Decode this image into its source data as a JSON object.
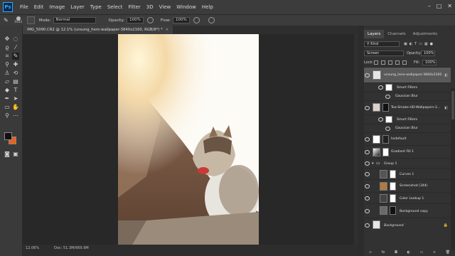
{
  "app": {
    "logo": "Ps"
  },
  "menu": [
    "File",
    "Edit",
    "Image",
    "Layer",
    "Type",
    "Select",
    "Filter",
    "3D",
    "View",
    "Window",
    "Help"
  ],
  "window_controls": {
    "minimize": "–",
    "maximize": "□",
    "close": "✕"
  },
  "options_bar": {
    "brush_size": "1011",
    "mode_label": "Mode:",
    "mode_value": "Normal",
    "opacity_label": "Opacity:",
    "opacity_value": "100%",
    "flow_label": "Flow:",
    "flow_value": "100%"
  },
  "document": {
    "tab_title": "IMG_5090.CR2 @ 12.1% (unsung_hero-wallpaper-3840x2160, RGB/8*) *",
    "close": "×"
  },
  "status_bar": {
    "zoom": "12.06%",
    "doc_size": "Doc: 51.3M/669.9M"
  },
  "colors": {
    "foreground": "#111111",
    "background": "#e8621c",
    "accent": "#31a8ff"
  },
  "panels": {
    "tabs": [
      "Layers",
      "Channels",
      "Adjustments"
    ],
    "active_tab": "Layers",
    "filter_kind": "Kind",
    "blend_mode": "Screen",
    "opacity_label": "Opacity:",
    "opacity_value": "100%",
    "lock_label": "Lock:",
    "fill_label": "Fill:",
    "fill_value": "100%"
  },
  "layers": [
    {
      "name": "unsung_hero-wallpaper-3840x2160",
      "type": "smart",
      "selected": true,
      "fx": true
    },
    {
      "name": "Smart Filters",
      "type": "filter-header"
    },
    {
      "name": "Gaussian Blur",
      "type": "filter"
    },
    {
      "name": "Tea-Smoke-HD-Wallpapers-2...",
      "type": "smart",
      "fx": true
    },
    {
      "name": "Smart Filters",
      "type": "filter-header"
    },
    {
      "name": "Gaussian Blur",
      "type": "filter"
    },
    {
      "name": "hsdefault",
      "type": "mask"
    },
    {
      "name": "Gradient Fill 1",
      "type": "adjustment"
    },
    {
      "name": "Group 1",
      "type": "group"
    },
    {
      "name": "Curves 1",
      "type": "adjustment"
    },
    {
      "name": "Screenshot (344)",
      "type": "mask"
    },
    {
      "name": "Color Lookup 1",
      "type": "adjustment"
    },
    {
      "name": "Background copy",
      "type": "mask"
    },
    {
      "name": "Background",
      "type": "locked"
    }
  ],
  "panel_bottom_icons": [
    "link-icon",
    "fx-icon",
    "mask-icon",
    "adjustment-icon",
    "folder-icon",
    "new-layer-icon",
    "trash-icon"
  ],
  "panel_bottom_glyphs": [
    "∞",
    "fx",
    "◘",
    "◐",
    "▭",
    "+",
    "🗑"
  ]
}
